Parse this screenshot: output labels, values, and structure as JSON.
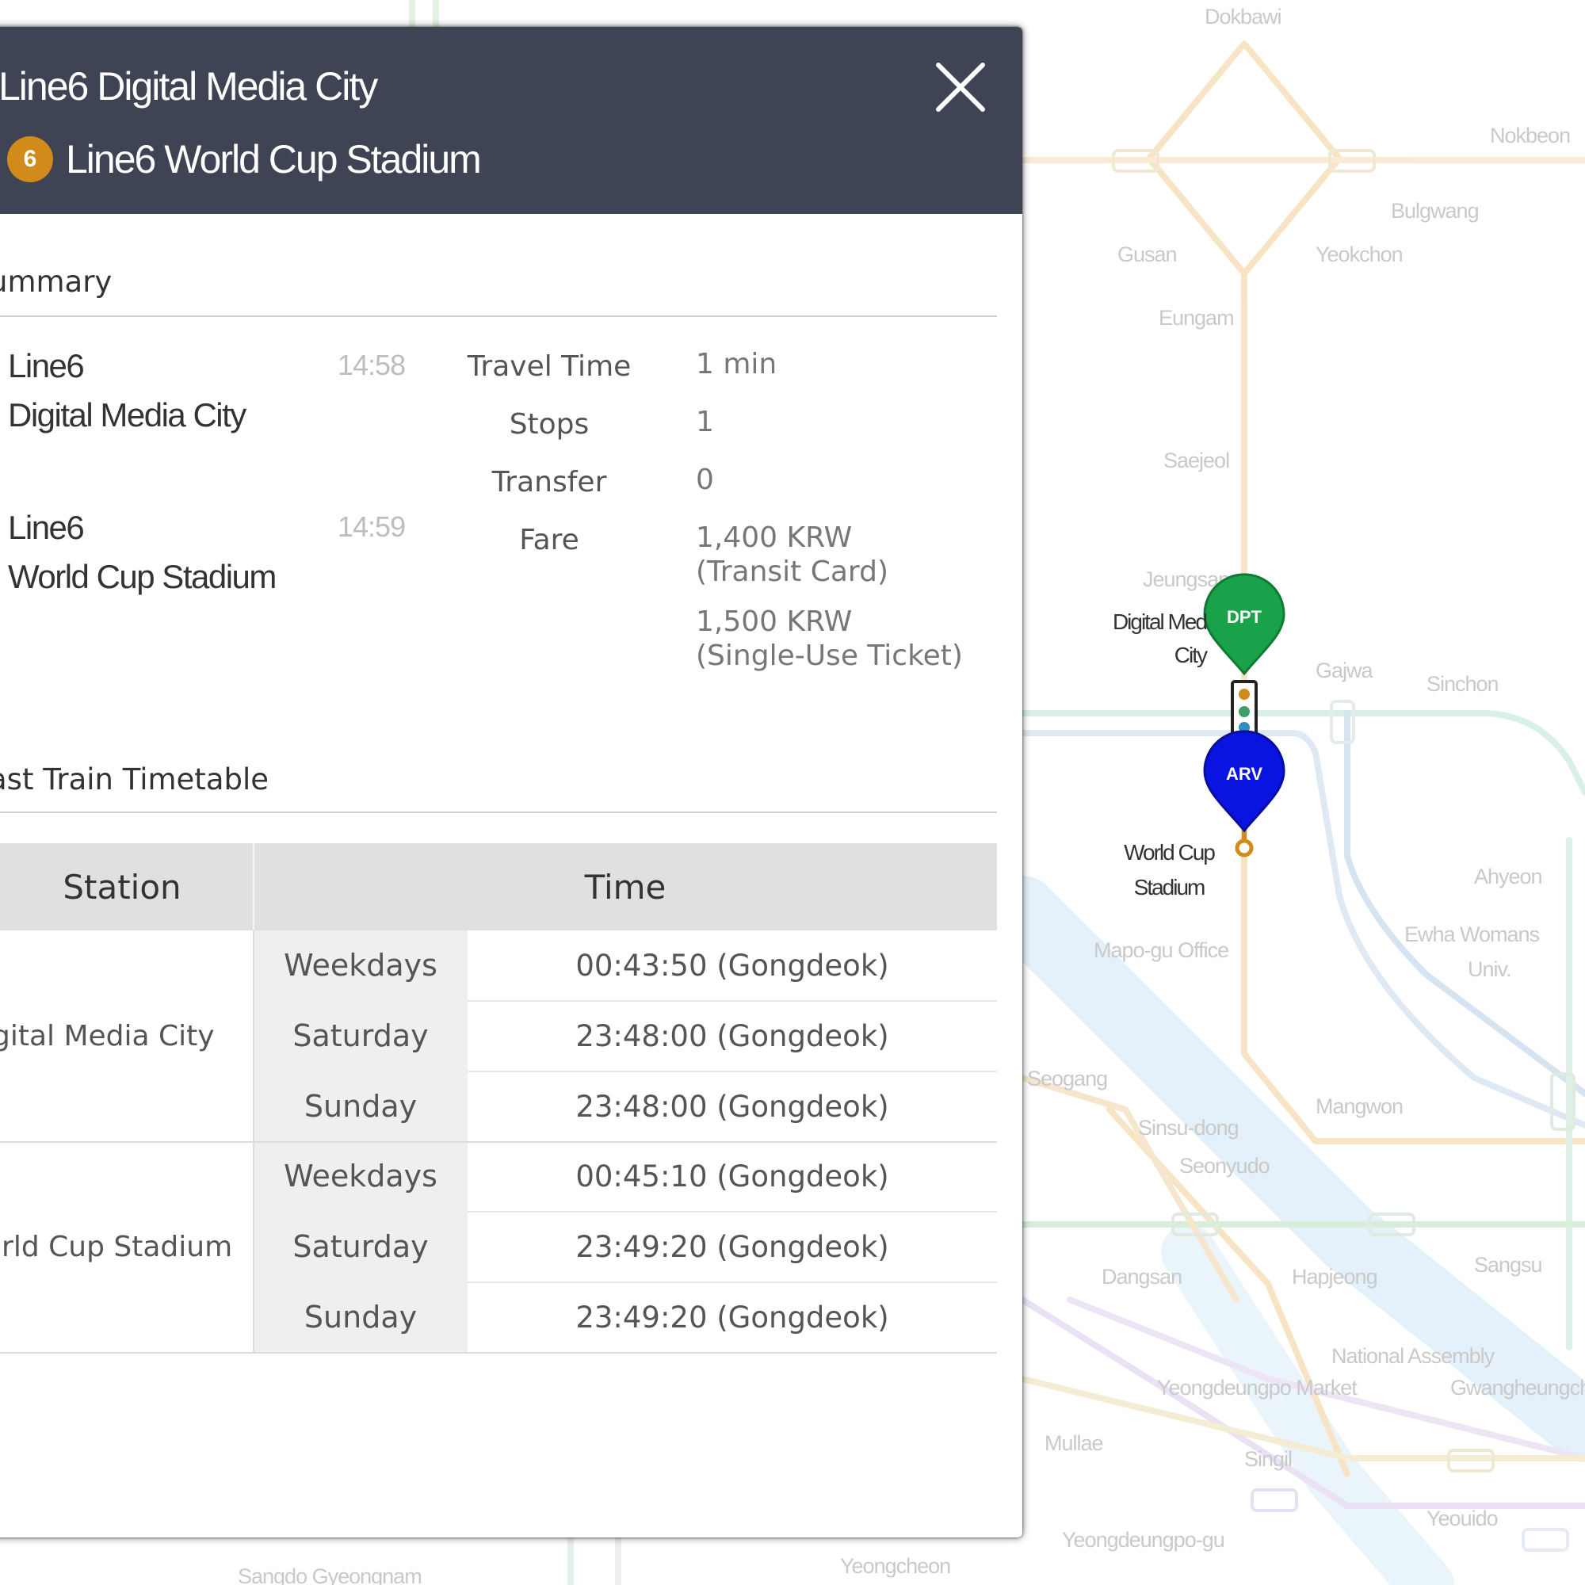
{
  "panel": {
    "origin_title": "Line6 Digital Media City",
    "line_badge": "6",
    "destination_title": "Line6 World Cup Stadium",
    "close_label": "close",
    "colors": {
      "header_bg": "#3e4453",
      "line6": "#d08b1a",
      "dpt_pin": "#1aa24a",
      "arv_pin": "#0a14e0"
    }
  },
  "summary": {
    "title": "ummary",
    "departure": {
      "line": "Line6",
      "station": "Digital Media City",
      "time": "14:58"
    },
    "arrival": {
      "line": "Line6",
      "station": "World Cup Stadium",
      "time": "14:59"
    },
    "travel_time_label": "Travel Time",
    "travel_time_value": "1 min",
    "stops_label": "Stops",
    "stops_value": "1",
    "transfer_label": "Transfer",
    "transfer_value": "0",
    "fare_label": "Fare",
    "fare_card_amount": "1,400 KRW",
    "fare_card_type": "(Transit Card)",
    "fare_ticket_amount": "1,500 KRW",
    "fare_ticket_type": "(Single-Use Ticket)"
  },
  "timetable": {
    "title": "ast Train Timetable",
    "header_station": "Station",
    "header_time": "Time",
    "groups": [
      {
        "station": "igital Media City",
        "rows": [
          {
            "day": "Weekdays",
            "time": "00:43:50 (Gongdeok)"
          },
          {
            "day": "Saturday",
            "time": "23:48:00 (Gongdeok)"
          },
          {
            "day": "Sunday",
            "time": "23:48:00 (Gongdeok)"
          }
        ]
      },
      {
        "station": "orld Cup Stadium",
        "rows": [
          {
            "day": "Weekdays",
            "time": "00:45:10 (Gongdeok)"
          },
          {
            "day": "Saturday",
            "time": "23:49:20 (Gongdeok)"
          },
          {
            "day": "Sunday",
            "time": "23:49:20 (Gongdeok)"
          }
        ]
      }
    ]
  },
  "map": {
    "dpt_pin_text": "DPT",
    "arv_pin_text": "ARV",
    "dpt_station_line1": "Digital Med",
    "dpt_station_line2": "City",
    "arv_station_line1": "World Cup",
    "arv_station_line2": "Stadium",
    "faded_labels": [
      "Dokbawi",
      "Nokbeon",
      "Bulgwang",
      "Yeokchon",
      "Gusan",
      "Eungam",
      "Saejeol",
      "Jeungsan",
      "Gajwa",
      "Sinchon",
      "Ahyeon",
      "Ewha Womans",
      "Univ.",
      "Mapo-gu Office",
      "Mangwon",
      "Seogang",
      "Sinsu-dong",
      "Seonyudo",
      "Dangsan",
      "Hapjeong",
      "Sangsu",
      "National Assembly",
      "Gwangheungchang",
      "Yeongdeungpo Market",
      "Singil",
      "Yeouido",
      "Yeongdeungpo-gu",
      "Mullae",
      "Sangdo Gyeongnam",
      "Yeongcheon"
    ]
  }
}
